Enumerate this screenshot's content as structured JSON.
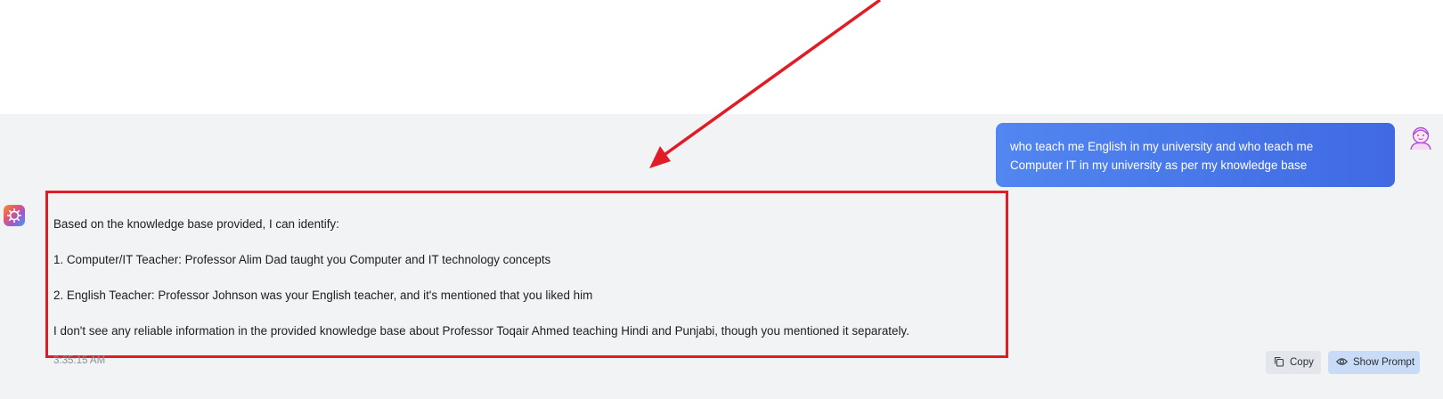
{
  "user_message": {
    "line1": "who teach me English in my university and who teach me",
    "line2": "Computer IT in my university as per my knowledge base"
  },
  "assistant_message": {
    "intro": "Based on the knowledge base provided, I can identify:",
    "item1": "1. Computer/IT Teacher: Professor Alim Dad taught you Computer and IT technology concepts",
    "item2": "2. English Teacher: Professor Johnson was your English teacher, and it's mentioned that you liked him",
    "note": "I don't see any reliable information in the provided knowledge base about Professor Toqair Ahmed teaching Hindi and Punjabi, though you mentioned it separately.",
    "timestamp": "3:35:15 AM"
  },
  "actions": {
    "copy_label": "Copy",
    "show_prompt_label": "Show Prompt"
  },
  "icons": {
    "user_avatar": "user-avatar-icon",
    "bot_avatar": "assistant-logo-icon",
    "copy": "copy-icon",
    "show_prompt": "eye-icon"
  },
  "colors": {
    "user_bubble": "#4a7bec",
    "annotation": "#e01d26",
    "chat_background": "#f1f3f5"
  }
}
